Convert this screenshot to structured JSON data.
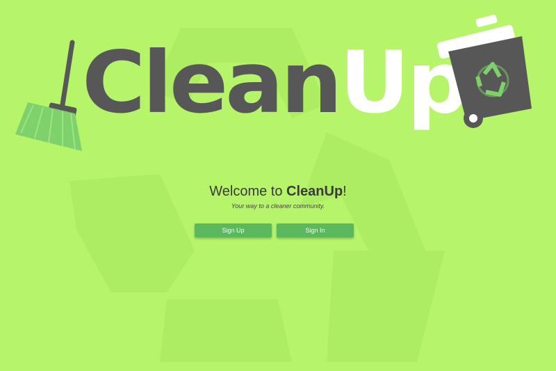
{
  "logo": {
    "word_clean": "Clean",
    "word_up": "Up",
    "icons": [
      "broom-icon",
      "recycle-bin-icon"
    ]
  },
  "welcome": {
    "prefix": "Welcome to ",
    "brand": "CleanUp",
    "suffix": "!",
    "tagline": "Your way to a cleaner community."
  },
  "buttons": {
    "sign_up": "Sign Up",
    "sign_in": "Sign In"
  },
  "colors": {
    "background": "#b6f56a",
    "logo_dark": "#575757",
    "logo_light": "#ffffff",
    "broom_green": "#7fd16b",
    "button": "#5cb85c"
  }
}
